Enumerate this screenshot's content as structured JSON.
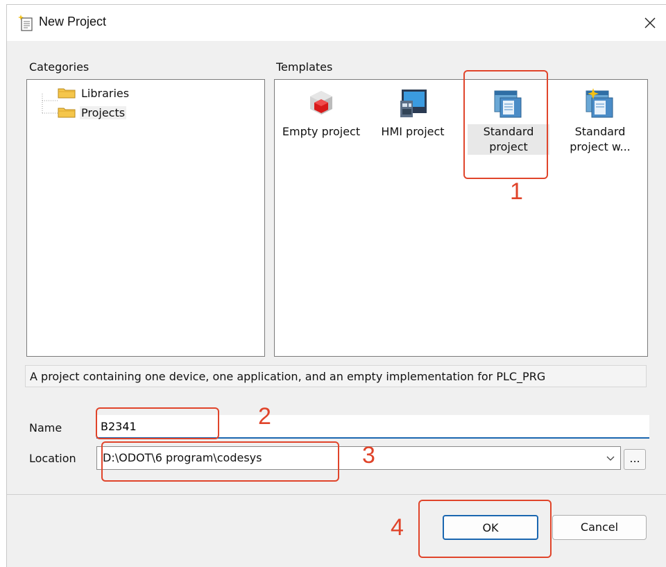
{
  "window": {
    "title": "New Project",
    "close_icon": "close-icon"
  },
  "categories": {
    "label": "Categories",
    "items": [
      {
        "label": "Libraries",
        "icon": "folder-icon"
      },
      {
        "label": "Projects",
        "icon": "folder-icon",
        "selected": true
      }
    ]
  },
  "templates": {
    "label": "Templates",
    "items": [
      {
        "label": "Empty project",
        "icon": "empty-project-icon"
      },
      {
        "label": "HMI project",
        "icon": "hmi-project-icon"
      },
      {
        "label": "Standard project",
        "icon": "standard-project-icon",
        "selected": true
      },
      {
        "label": "Standard project w...",
        "icon": "standard-project-wizard-icon"
      }
    ]
  },
  "description": "A project containing one device, one application, and an empty implementation for PLC_PRG",
  "form": {
    "name_label": "Name",
    "name_value": "B2341",
    "location_label": "Location",
    "location_value": "D:\\ODOT\\6 program\\codesys",
    "browse_label": "..."
  },
  "buttons": {
    "ok": "OK",
    "cancel": "Cancel"
  },
  "annotations": [
    "1",
    "2",
    "3",
    "4"
  ],
  "colors": {
    "annotation": "#e0442a",
    "accent": "#1a66b0",
    "dialog_bg": "#f0f0f0"
  }
}
